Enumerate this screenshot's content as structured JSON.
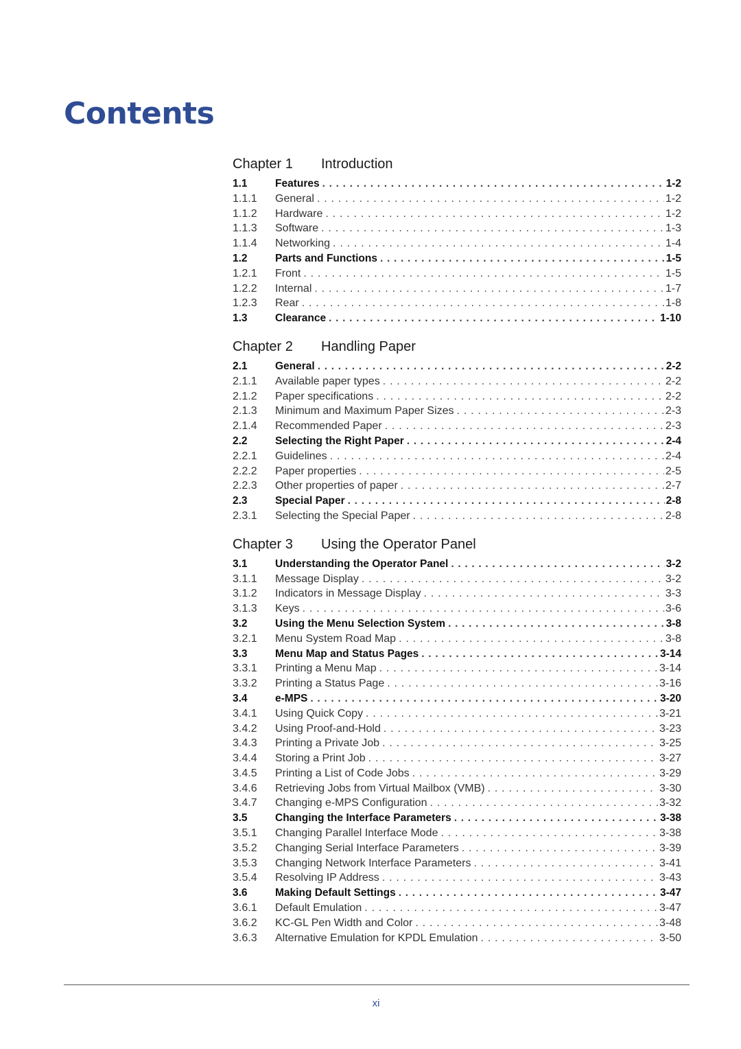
{
  "page": {
    "title": "Contents",
    "page_number": "xi",
    "accent_color": "#2f4c94"
  },
  "chapters": [
    {
      "label": "Chapter 1",
      "title": "Introduction",
      "entries": [
        {
          "num": "1.1",
          "title": "Features",
          "page": "1-2",
          "level": 1
        },
        {
          "num": "1.1.1",
          "title": "General",
          "page": "1-2",
          "level": 2
        },
        {
          "num": "1.1.2",
          "title": "Hardware",
          "page": "1-2",
          "level": 2
        },
        {
          "num": "1.1.3",
          "title": "Software",
          "page": "1-3",
          "level": 2
        },
        {
          "num": "1.1.4",
          "title": "Networking",
          "page": "1-4",
          "level": 2
        },
        {
          "num": "1.2",
          "title": "Parts and Functions",
          "page": "1-5",
          "level": 1
        },
        {
          "num": "1.2.1",
          "title": "Front",
          "page": "1-5",
          "level": 2
        },
        {
          "num": "1.2.2",
          "title": "Internal",
          "page": "1-7",
          "level": 2
        },
        {
          "num": "1.2.3",
          "title": "Rear",
          "page": "1-8",
          "level": 2
        },
        {
          "num": "1.3",
          "title": "Clearance",
          "page": "1-10",
          "level": 1
        }
      ]
    },
    {
      "label": "Chapter 2",
      "title": "Handling Paper",
      "entries": [
        {
          "num": "2.1",
          "title": "General",
          "page": "2-2",
          "level": 1
        },
        {
          "num": "2.1.1",
          "title": "Available paper types",
          "page": "2-2",
          "level": 2
        },
        {
          "num": "2.1.2",
          "title": "Paper specifications",
          "page": "2-2",
          "level": 2
        },
        {
          "num": "2.1.3",
          "title": "Minimum and Maximum Paper Sizes",
          "page": "2-3",
          "level": 2
        },
        {
          "num": "2.1.4",
          "title": "Recommended Paper",
          "page": "2-3",
          "level": 2
        },
        {
          "num": "2.2",
          "title": "Selecting the Right Paper",
          "page": "2-4",
          "level": 1
        },
        {
          "num": "2.2.1",
          "title": "Guidelines",
          "page": "2-4",
          "level": 2
        },
        {
          "num": "2.2.2",
          "title": "Paper properties",
          "page": "2-5",
          "level": 2
        },
        {
          "num": "2.2.3",
          "title": "Other properties of paper",
          "page": "2-7",
          "level": 2
        },
        {
          "num": "2.3",
          "title": "Special Paper",
          "page": "2-8",
          "level": 1
        },
        {
          "num": "2.3.1",
          "title": "Selecting the Special Paper",
          "page": "2-8",
          "level": 2
        }
      ]
    },
    {
      "label": "Chapter 3",
      "title": "Using the Operator Panel",
      "entries": [
        {
          "num": "3.1",
          "title": "Understanding the Operator Panel",
          "page": "3-2",
          "level": 1
        },
        {
          "num": "3.1.1",
          "title": "Message Display",
          "page": "3-2",
          "level": 2
        },
        {
          "num": "3.1.2",
          "title": "Indicators in Message Display",
          "page": "3-3",
          "level": 2
        },
        {
          "num": "3.1.3",
          "title": "Keys",
          "page": "3-6",
          "level": 2
        },
        {
          "num": "3.2",
          "title": "Using the Menu Selection System",
          "page": "3-8",
          "level": 1
        },
        {
          "num": "3.2.1",
          "title": "Menu System Road Map",
          "page": "3-8",
          "level": 2
        },
        {
          "num": "3.3",
          "title": "Menu Map and Status Pages",
          "page": "3-14",
          "level": 1
        },
        {
          "num": "3.3.1",
          "title": "Printing a Menu Map",
          "page": "3-14",
          "level": 2
        },
        {
          "num": "3.3.2",
          "title": "Printing a Status Page",
          "page": "3-16",
          "level": 2
        },
        {
          "num": "3.4",
          "title": "e-MPS",
          "page": "3-20",
          "level": 1
        },
        {
          "num": "3.4.1",
          "title": "Using Quick Copy",
          "page": "3-21",
          "level": 2
        },
        {
          "num": "3.4.2",
          "title": "Using Proof-and-Hold",
          "page": "3-23",
          "level": 2
        },
        {
          "num": "3.4.3",
          "title": "Printing a Private Job",
          "page": "3-25",
          "level": 2
        },
        {
          "num": "3.4.4",
          "title": "Storing a Print Job",
          "page": "3-27",
          "level": 2
        },
        {
          "num": "3.4.5",
          "title": "Printing a List of Code Jobs",
          "page": "3-29",
          "level": 2
        },
        {
          "num": "3.4.6",
          "title": "Retrieving Jobs from Virtual Mailbox (VMB)",
          "page": "3-30",
          "level": 2
        },
        {
          "num": "3.4.7",
          "title": "Changing e-MPS Configuration",
          "page": "3-32",
          "level": 2
        },
        {
          "num": "3.5",
          "title": "Changing the Interface Parameters",
          "page": "3-38",
          "level": 1
        },
        {
          "num": "3.5.1",
          "title": "Changing Parallel Interface Mode",
          "page": "3-38",
          "level": 2
        },
        {
          "num": "3.5.2",
          "title": "Changing Serial Interface Parameters",
          "page": "3-39",
          "level": 2
        },
        {
          "num": "3.5.3",
          "title": "Changing Network Interface Parameters",
          "page": "3-41",
          "level": 2
        },
        {
          "num": "3.5.4",
          "title": "Resolving IP Address",
          "page": "3-43",
          "level": 2
        },
        {
          "num": "3.6",
          "title": "Making Default Settings",
          "page": "3-47",
          "level": 1
        },
        {
          "num": "3.6.1",
          "title": "Default Emulation",
          "page": "3-47",
          "level": 2
        },
        {
          "num": "3.6.2",
          "title": "KC-GL Pen Width and Color",
          "page": "3-48",
          "level": 2
        },
        {
          "num": "3.6.3",
          "title": "Alternative Emulation for KPDL Emulation",
          "page": "3-50",
          "level": 2
        }
      ]
    }
  ]
}
